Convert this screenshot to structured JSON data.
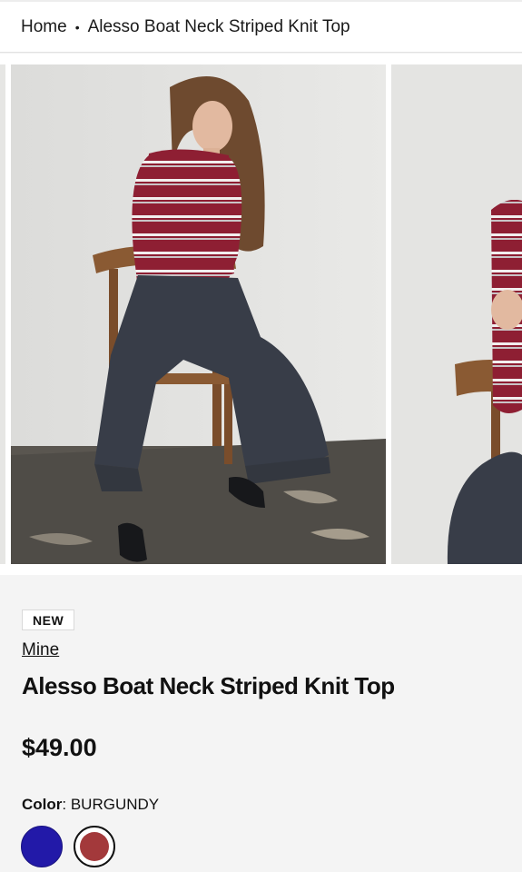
{
  "breadcrumb": {
    "home_label": "Home",
    "separator": "•",
    "current_label": "Alesso Boat Neck Striped Knit Top"
  },
  "gallery": {
    "slide_count": 5,
    "active_index": 3
  },
  "product": {
    "badge": "NEW",
    "brand": "Mine",
    "title": "Alesso Boat Neck Striped Knit Top",
    "price": "$49.00",
    "color_label": "Color",
    "color_value": "BURGUNDY",
    "swatches": [
      {
        "name": "navy",
        "color": "#2219a8",
        "selected": false
      },
      {
        "name": "burgundy",
        "color": "#a3393b",
        "selected": true
      }
    ]
  },
  "colors": {
    "background": "#f4f4f4",
    "sweater_burgundy": "#8e1f33",
    "pants_charcoal": "#383d48"
  }
}
